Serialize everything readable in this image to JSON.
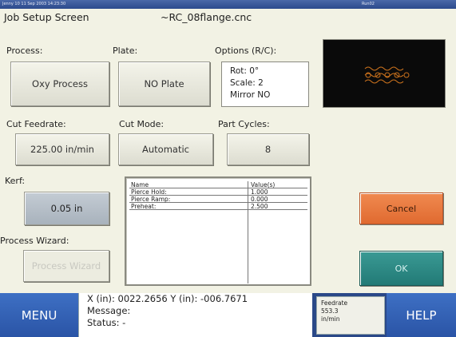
{
  "topbar": {
    "timestamp": "Jenny 10  11 Sep 2003  14:23:30",
    "run": "Run02"
  },
  "screen": {
    "title": "Job Setup Screen",
    "filename": "~RC_08flange.cnc"
  },
  "process": {
    "label": "Process:",
    "value": "Oxy Process"
  },
  "plate": {
    "label": "Plate:",
    "value": "NO Plate"
  },
  "options": {
    "label": "Options (R/C):",
    "rot": "Rot: 0°",
    "scale": "Scale: 2",
    "mirror": "Mirror NO"
  },
  "preview": {
    "shape": "flange-pattern-preview"
  },
  "cut_feedrate": {
    "label": "Cut Feedrate:",
    "value": "225.00 in/min"
  },
  "cut_mode": {
    "label": "Cut Mode:",
    "value": "Automatic"
  },
  "part_cycles": {
    "label": "Part Cycles:",
    "value": "8"
  },
  "kerf": {
    "label": "Kerf:",
    "value": "0.05 in"
  },
  "wizard": {
    "label": "Process Wizard:",
    "button": "Process Wizard"
  },
  "params": {
    "headers": {
      "name": "Name",
      "value": "Value(s)"
    },
    "rows": [
      {
        "name": "Pierce Hold:",
        "value": "1.000"
      },
      {
        "name": "Pierce Ramp:",
        "value": "0.000"
      },
      {
        "name": "Preheat:",
        "value": "2.500"
      }
    ]
  },
  "actions": {
    "cancel": "Cancel",
    "ok": "OK"
  },
  "bottombar": {
    "menu": "MENU",
    "help": "HELP",
    "position": "X (in): 0022.2656   Y (in): -006.7671",
    "message": "Message:",
    "status": "Status:  -",
    "feed_label": "Feedrate",
    "feed_value": "553.3",
    "feed_unit": "in/min"
  },
  "colors": {
    "cancel": "#e8723a",
    "ok": "#2a8a84",
    "bar": "#2a4888",
    "preview_trace": "#c8701c"
  }
}
